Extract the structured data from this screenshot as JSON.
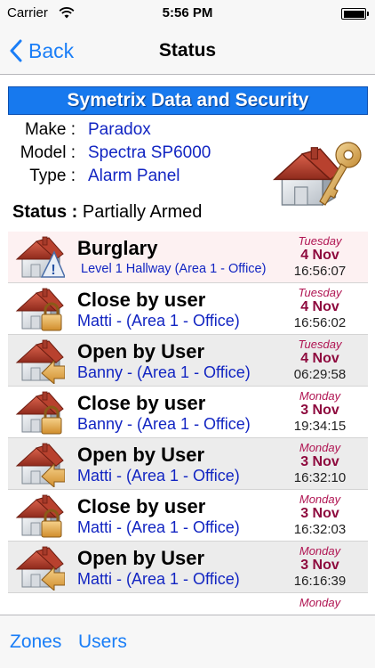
{
  "status_bar": {
    "carrier": "Carrier",
    "time": "5:56 PM"
  },
  "nav": {
    "back_label": "Back",
    "title": "Status"
  },
  "header": {
    "banner": "Symetrix Data and Security",
    "make_label": "Make :",
    "make_value": "Paradox",
    "model_label": "Model :",
    "model_value": "Spectra SP6000",
    "type_label": "Type :",
    "type_value": "Alarm Panel",
    "status_label": "Status :",
    "status_value": "Partially Armed"
  },
  "events": [
    {
      "title": "Burglary",
      "subtitle": "Level 1 Hallway (Area 1 - Office)",
      "day": "Tuesday",
      "date": "4 Nov",
      "time": "16:56:07",
      "icon": "alarm-house-icon"
    },
    {
      "title": "Close by user",
      "subtitle": "Matti -  (Area 1 - Office)",
      "day": "Tuesday",
      "date": "4 Nov",
      "time": "16:56:02",
      "icon": "locked-house-icon"
    },
    {
      "title": "Open by User",
      "subtitle": "Banny -  (Area 1 - Office)",
      "day": "Tuesday",
      "date": "4 Nov",
      "time": "06:29:58",
      "icon": "unlocked-house-icon"
    },
    {
      "title": "Close by user",
      "subtitle": "Banny -  (Area 1 - Office)",
      "day": "Monday",
      "date": "3 Nov",
      "time": "19:34:15",
      "icon": "locked-house-icon"
    },
    {
      "title": "Open by User",
      "subtitle": "Matti -  (Area 1 - Office)",
      "day": "Monday",
      "date": "3 Nov",
      "time": "16:32:10",
      "icon": "unlocked-house-icon"
    },
    {
      "title": "Close by user",
      "subtitle": "Matti -  (Area 1 - Office)",
      "day": "Monday",
      "date": "3 Nov",
      "time": "16:32:03",
      "icon": "locked-house-icon"
    },
    {
      "title": "Open by User",
      "subtitle": "Matti -  (Area 1 - Office)",
      "day": "Monday",
      "date": "3 Nov",
      "time": "16:16:39",
      "icon": "unlocked-house-icon"
    },
    {
      "title": "",
      "subtitle": "",
      "day": "Monday",
      "date": "",
      "time": "",
      "icon": ""
    }
  ],
  "toolbar": {
    "zones_label": "Zones",
    "users_label": "Users"
  },
  "colors": {
    "accent": "#1a7ef7",
    "banner": "#1779ee",
    "value_text": "#1225c2",
    "date_text": "#8e0a3e"
  }
}
